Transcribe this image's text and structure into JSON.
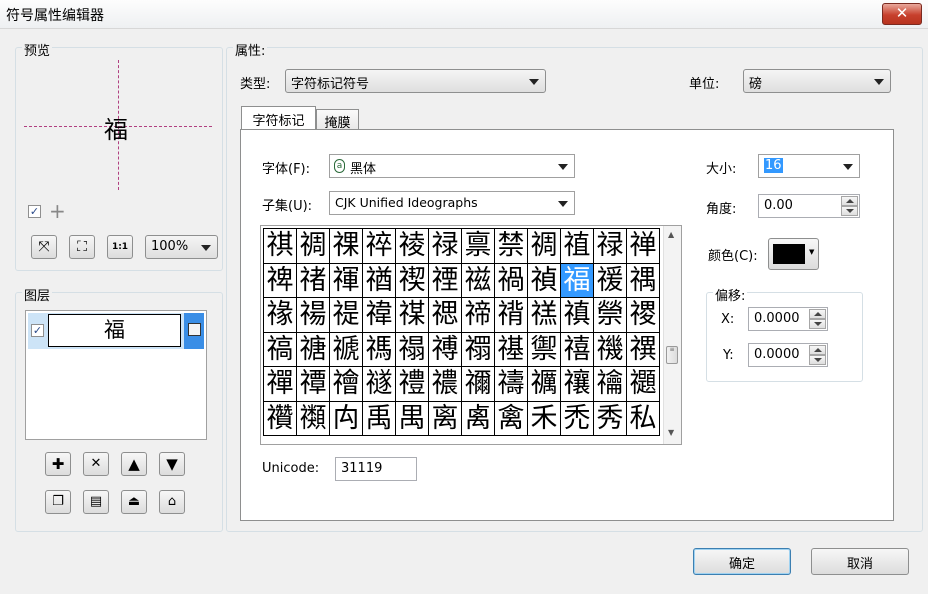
{
  "window": {
    "title": "符号属性编辑器",
    "close_glyph": "✕"
  },
  "preview": {
    "label": "预览",
    "glyph": "福",
    "zoom": "100%",
    "checkbox_checked": true
  },
  "layers": {
    "label": "图层",
    "items": [
      {
        "glyph": "福",
        "checked": true
      }
    ]
  },
  "properties": {
    "label": "属性:",
    "type_label": "类型:",
    "type_value": "字符标记符号",
    "unit_label": "单位:",
    "unit_value": "磅",
    "tabs": [
      {
        "label": "字符标记"
      },
      {
        "label": "掩膜"
      }
    ],
    "font_label": "字体(F):",
    "font_value": "黑体",
    "subset_label": "子集(U):",
    "subset_value": "CJK Unified Ideographs",
    "size_label": "大小:",
    "size_value": "16",
    "angle_label": "角度:",
    "angle_value": "0.00",
    "color_label": "颜色(C):",
    "color_value": "#000000",
    "offset_label": "偏移:",
    "x_label": "X:",
    "x_value": "0.0000",
    "y_label": "Y:",
    "y_value": "0.0000",
    "unicode_label": "Unicode:",
    "unicode_value": "31119"
  },
  "char_grid": {
    "selected": "福",
    "rows": [
      [
        "祺",
        "禂",
        "祼",
        "祽",
        "祾",
        "禄",
        "禀",
        "禁",
        "禂",
        "禃",
        "禄",
        "禅"
      ],
      [
        "禆",
        "禇",
        "禈",
        "禉",
        "禊",
        "禋",
        "禌",
        "禍",
        "禎",
        "福",
        "禐",
        "禑"
      ],
      [
        "禒",
        "禓",
        "禔",
        "禕",
        "禖",
        "禗",
        "禘",
        "禙",
        "禚",
        "禛",
        "禜",
        "禝"
      ],
      [
        "禞",
        "禟",
        "禠",
        "禡",
        "禢",
        "禣",
        "禤",
        "禥",
        "禦",
        "禧",
        "禨",
        "禩"
      ],
      [
        "禪",
        "禫",
        "禬",
        "禭",
        "禮",
        "禯",
        "禰",
        "禱",
        "禲",
        "禳",
        "禴",
        "禵"
      ],
      [
        "禶",
        "禷",
        "禸",
        "禹",
        "禺",
        "离",
        "禼",
        "禽",
        "禾",
        "禿",
        "秀",
        "私"
      ]
    ]
  },
  "buttons": {
    "ok": "确定",
    "cancel": "取消"
  },
  "icons": {
    "plus": "✚",
    "delete": "✕",
    "up": "🡅",
    "down": "🡇",
    "fit": "⤧",
    "fullscreen": "⛶",
    "actual": "1:1"
  }
}
